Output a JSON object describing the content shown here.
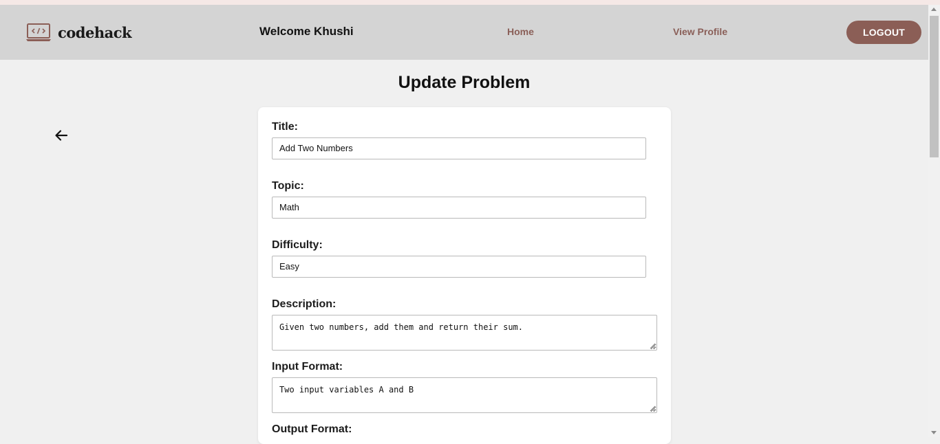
{
  "brand": {
    "name": "codehack",
    "icon": "laptop-code-icon",
    "color": "#8b5e56"
  },
  "nav": {
    "welcome": "Welcome Khushi",
    "home": "Home",
    "view_profile": "View Profile",
    "logout": "LOGOUT"
  },
  "page": {
    "title": "Update Problem",
    "back_icon": "arrow-left-icon"
  },
  "form": {
    "title_label": "Title:",
    "title_value": "Add Two Numbers",
    "topic_label": "Topic:",
    "topic_value": "Math",
    "difficulty_label": "Difficulty:",
    "difficulty_value": "Easy",
    "description_label": "Description:",
    "description_value": "Given two numbers, add them and return their sum.",
    "input_format_label": "Input Format:",
    "input_format_value": "Two input variables A and B",
    "output_format_label": "Output Format:"
  },
  "colors": {
    "navbar_bg": "#d4d4d4",
    "page_bg": "#f0f0f0",
    "link": "#8a5f58",
    "button": "#8b5e56"
  }
}
